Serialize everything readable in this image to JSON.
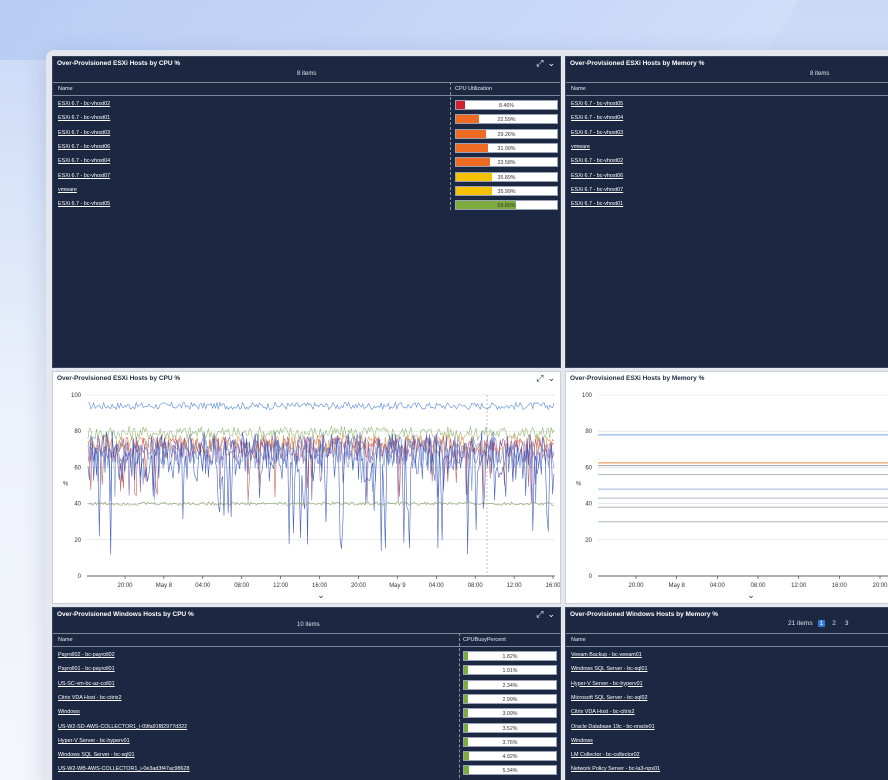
{
  "p1": {
    "title": "Over-Provisioned ESXi Hosts by CPU %",
    "count": "8 items",
    "col_name": "Name",
    "col_metric": "CPU Utilization",
    "rows": [
      {
        "name": "ESXi 6.7 - bc-vhost02",
        "pct": "8.46%",
        "v": 8.46,
        "color": "#d0202c"
      },
      {
        "name": "ESXi 6.7 - bc-vhost01",
        "pct": "22.59%",
        "v": 22.59,
        "color": "#ef6a23"
      },
      {
        "name": "ESXi 6.7 - bc-vhost03",
        "pct": "29.26%",
        "v": 29.26,
        "color": "#ef6a23"
      },
      {
        "name": "ESXi 6.7 - bc-vhost06",
        "pct": "31.99%",
        "v": 31.99,
        "color": "#ef6a23"
      },
      {
        "name": "ESXi 6.7 - bc-vhost04",
        "pct": "33.58%",
        "v": 33.58,
        "color": "#ef6a23"
      },
      {
        "name": "ESXi 6.7 - bc-vhost07",
        "pct": "35.89%",
        "v": 35.89,
        "color": "#f6c200"
      },
      {
        "name": "vmware",
        "pct": "35.99%",
        "v": 35.99,
        "color": "#f6c200"
      },
      {
        "name": "ESXi 6.7 - bc-vhost05",
        "pct": "59.80%",
        "v": 59.8,
        "color": "#7cab3e"
      }
    ]
  },
  "p2": {
    "title": "Over-Provisioned ESXi Hosts by Memory %",
    "count": "8 items",
    "col_name": "Name",
    "rows": [
      {
        "name": "ESXi 6.7 - bc-vhost05"
      },
      {
        "name": "ESXi 6.7 - bc-vhost04"
      },
      {
        "name": "ESXi 6.7 - bc-vhost03"
      },
      {
        "name": "vmware"
      },
      {
        "name": "ESXi 6.7 - bc-vhost02"
      },
      {
        "name": "ESXi 6.7 - bc-vhost06"
      },
      {
        "name": "ESXi 6.7 - bc-vhost07"
      },
      {
        "name": "ESXi 6.7 - bc-vhost01"
      }
    ]
  },
  "p3": {
    "title": "Over-Provisioned ESXi Hosts by CPU %",
    "chart_data": {
      "type": "line",
      "ylabel": "%",
      "ylim": [
        0,
        100
      ],
      "yticks": [
        0,
        20,
        40,
        60,
        80,
        100
      ],
      "xticks": [
        "20:00",
        "May 8",
        "04:00",
        "08:00",
        "12:00",
        "16:00",
        "20:00",
        "May 9",
        "04:00",
        "08:00",
        "12:00",
        "16:00"
      ],
      "series": [
        {
          "color": "#4a7fd6",
          "base": 94,
          "amp": 2
        },
        {
          "color": "#8db06a",
          "base": 79,
          "amp": 4
        },
        {
          "color": "#e28a3a",
          "base": 73,
          "amp": 5
        },
        {
          "color": "#c9544e",
          "base": 71,
          "amp": 6
        },
        {
          "color": "#6a8dc9",
          "base": 68,
          "amp": 9
        },
        {
          "color": "#7a5aa8",
          "base": 70,
          "amp": 8
        },
        {
          "color": "#3551b8",
          "base": 66,
          "amp": 14
        },
        {
          "color": "#7a9b5a",
          "base": 40,
          "amp": 1
        }
      ]
    }
  },
  "p4": {
    "title": "Over-Provisioned ESXi Hosts by Memory %",
    "chart_data": {
      "type": "line",
      "ylabel": "%",
      "ylim": [
        0,
        100
      ],
      "yticks": [
        0,
        20,
        40,
        60,
        80,
        100
      ],
      "xticks": [
        "20:00",
        "May 8",
        "04:00",
        "08:00",
        "12:00",
        "16:00",
        "20:00"
      ],
      "series": [
        {
          "color": "#7aa7e6",
          "value": 78
        },
        {
          "color": "#e28a3a",
          "value": 62.5
        },
        {
          "color": "#9aa3b4",
          "value": 61
        },
        {
          "color": "#b0b6c2",
          "value": 56
        },
        {
          "color": "#9fb0d8",
          "value": 48
        },
        {
          "color": "#b0b6c2",
          "value": 43
        },
        {
          "color": "#b0b6c2",
          "value": 38
        },
        {
          "color": "#b0b6c2",
          "value": 30
        }
      ]
    }
  },
  "p5": {
    "title": "Over-Provisioned Windows Hosts by CPU %",
    "count": "10 items",
    "col_name": "Name",
    "col_metric": "CPUBusyPercent",
    "rows": [
      {
        "name": "Payroll02 - bc-payroll02",
        "pct": "1.82%",
        "v": 1.82
      },
      {
        "name": "Payroll01 - bc-payroll01",
        "pct": "1.91%",
        "v": 1.91
      },
      {
        "name": "US-SC-vm-bc-az-coll01",
        "pct": "2.34%",
        "v": 2.34
      },
      {
        "name": "Citrix VDA Host - bc-citrix2",
        "pct": "2.99%",
        "v": 2.99
      },
      {
        "name": "Windows",
        "pct": "3.09%",
        "v": 3.09
      },
      {
        "name": "US-W2-SD-AWS-COLLECTOR1_i-09fa91f82977d322",
        "pct": "3.52%",
        "v": 3.52
      },
      {
        "name": "Hyper-V Server - bc-hyperv01",
        "pct": "3.76%",
        "v": 3.76
      },
      {
        "name": "Windows SQL Server - bc-sql01",
        "pct": "4.92%",
        "v": 4.92
      },
      {
        "name": "US-W2-WB-AWS-COLLECTOR1_i-0e3ad3f47ac98628",
        "pct": "5.34%",
        "v": 5.34
      }
    ]
  },
  "p6": {
    "title": "Over-Provisioned Windows Hosts by Memory %",
    "count": "21 items",
    "col_name": "Name",
    "pages": [
      "1",
      "2",
      "3"
    ],
    "rows": [
      {
        "name": "Veeam Backup - bc-veeam01"
      },
      {
        "name": "Windows SQL Server - bc-sql01"
      },
      {
        "name": "Hyper-V Server - bc-hyperv01"
      },
      {
        "name": "Microsoft SQL Server - bc-sql02"
      },
      {
        "name": "Citrix VDA Host - bc-citrix2"
      },
      {
        "name": "Oracle Database 19c - bc-oracle01"
      },
      {
        "name": "Windows"
      },
      {
        "name": "LM Collector - bc-collector02"
      },
      {
        "name": "Network Policy Server - bc-la3-nps01"
      }
    ]
  },
  "icons": {
    "expand": "expand-icon",
    "collapse": "chevron-down-icon"
  }
}
